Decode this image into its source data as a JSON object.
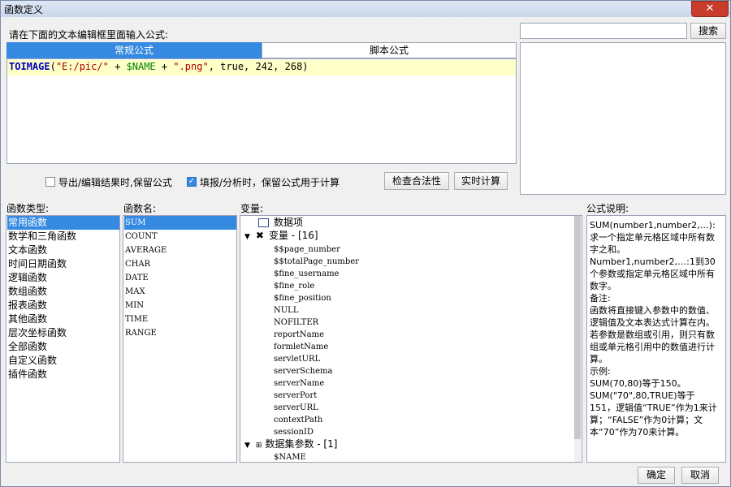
{
  "window": {
    "title": "函数定义",
    "close_label": "✕"
  },
  "editor": {
    "prompt": "请在下面的文本编辑框里面输入公式:",
    "tabs": [
      {
        "label": "常规公式"
      },
      {
        "label": "脚本公式"
      }
    ],
    "formula": {
      "fn": "TOIMAGE",
      "open": "(",
      "s1": "\"E:/pic/\"",
      "plus1": " + ",
      "v1": "$NAME",
      "plus2": " + ",
      "s2": "\".png\"",
      "rest": ", true, 242, 268)"
    }
  },
  "search": {
    "value": "",
    "button": "搜索"
  },
  "options": {
    "export_keep": {
      "label": "导出/编辑结果时,保留公式",
      "checked": false
    },
    "fill_keep": {
      "label": "填报/分析时，保留公式用于计算",
      "checked": true
    }
  },
  "buttons": {
    "check": "检查合法性",
    "realtime": "实时计算",
    "ok": "确定",
    "cancel": "取消"
  },
  "categories": {
    "header": "函数类型:",
    "items": [
      "常用函数",
      "数学和三角函数",
      "文本函数",
      "时间日期函数",
      "逻辑函数",
      "数组函数",
      "报表函数",
      "其他函数",
      "层次坐标函数",
      "全部函数",
      "自定义函数",
      "插件函数"
    ]
  },
  "functions": {
    "header": "函数名:",
    "items": [
      "SUM",
      "COUNT",
      "AVERAGE",
      "CHAR",
      "DATE",
      "MAX",
      "MIN",
      "TIME",
      "RANGE"
    ]
  },
  "variables": {
    "header": "变量:",
    "data_item": "数据项",
    "var_group": "变量 - [16]",
    "vars": [
      "$$page_number",
      "$$totalPage_number",
      "$fine_username",
      "$fine_role",
      "$fine_position",
      "NULL",
      "NOFILTER",
      "reportName",
      "formletName",
      "servletURL",
      "serverSchema",
      "serverName",
      "serverPort",
      "serverURL",
      "contextPath",
      "sessionID"
    ],
    "dataset_group": "数据集参数 - [1]",
    "dataset_params": [
      "$NAME"
    ]
  },
  "description": {
    "header": "公式说明:",
    "lines": [
      "SUM(number1,number2,…):求一个指定单元格区域中所有数字之和。",
      "Number1,number2,…:1到30个参数或指定单元格区域中所有数字。",
      "备注:",
      "函数将直接键入参数中的数值、逻辑值及文本表达式计算在内。若参数是数组或引用，则只有数组或单元格引用中的数值进行计算。",
      "示例:",
      "SUM(70,80)等于150。",
      "SUM(\"70\",80,TRUE)等于151，逻辑值“TRUE”作为1来计算；“FALSE”作为0计算；文本“70”作为70来计算。"
    ]
  }
}
